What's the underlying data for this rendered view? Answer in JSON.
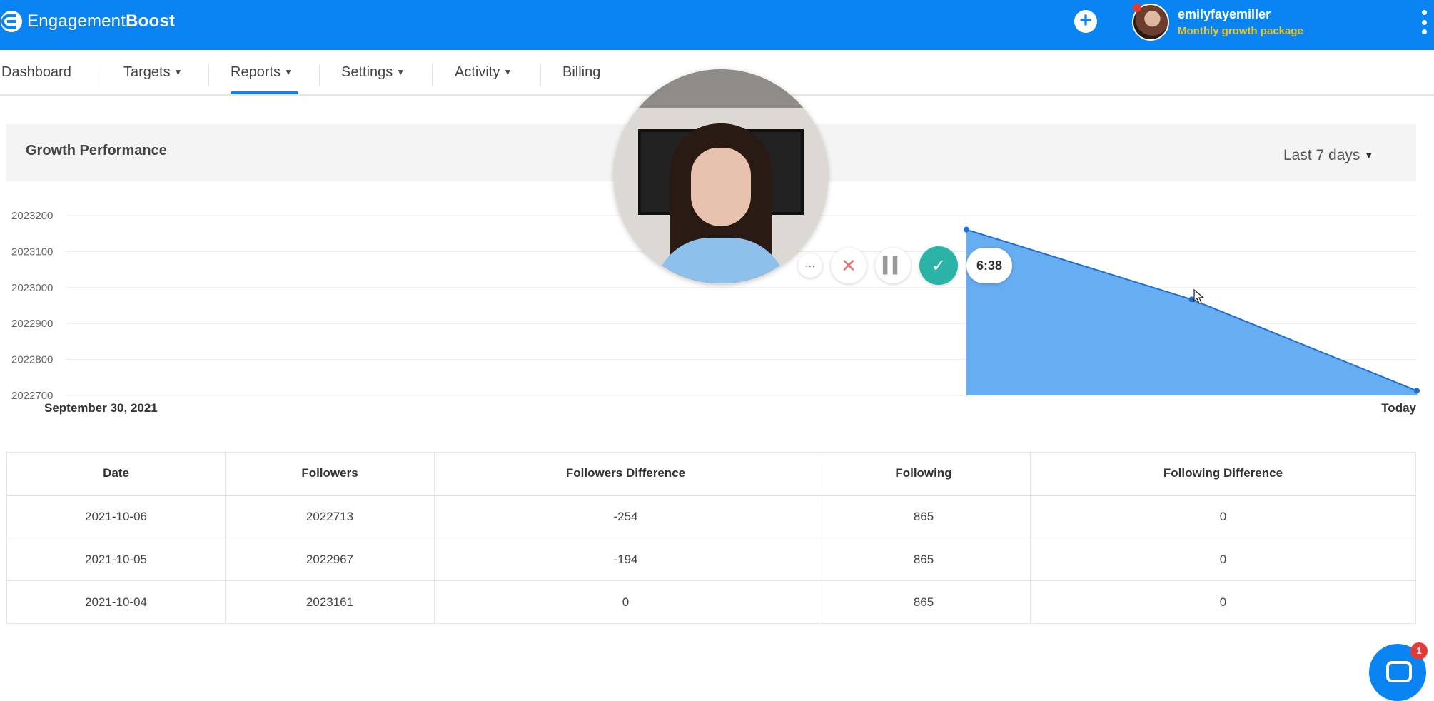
{
  "app": {
    "brand_light": "Engagement",
    "brand_bold": "Boost",
    "accent_color": "#0b84f3"
  },
  "user": {
    "name": "emilyfayemiller",
    "package": "Monthly growth package"
  },
  "nav": {
    "dashboard": "Dashboard",
    "targets": "Targets",
    "reports": "Reports",
    "settings": "Settings",
    "activity": "Activity",
    "billing": "Billing",
    "active": "Reports"
  },
  "panel": {
    "title": "Growth Performance",
    "range": "Last 7 days"
  },
  "chart_data": {
    "type": "area",
    "x": [
      "2021-10-04",
      "2021-10-05",
      "2021-10-06"
    ],
    "y": [
      2023161,
      2022967,
      2022713
    ],
    "ylim": [
      2022700,
      2023200
    ],
    "yticks": [
      "2023200",
      "2023100",
      "2023000",
      "2022900",
      "2022800",
      "2022700"
    ],
    "x_start_label": "September 30, 2021",
    "x_end_label": "Today",
    "grid": true,
    "fill_color": "#5fa9f0",
    "line_color": "#1f6fd1"
  },
  "table": {
    "headers": [
      "Date",
      "Followers",
      "Followers Difference",
      "Following",
      "Following Difference"
    ],
    "rows": [
      [
        "2021-10-06",
        "2022713",
        "-254",
        "865",
        "0"
      ],
      [
        "2021-10-05",
        "2022967",
        "-194",
        "865",
        "0"
      ],
      [
        "2021-10-04",
        "2023161",
        "0",
        "865",
        "0"
      ]
    ]
  },
  "recorder": {
    "timer": "6:38",
    "more": "···"
  },
  "chat": {
    "badge": "1"
  }
}
